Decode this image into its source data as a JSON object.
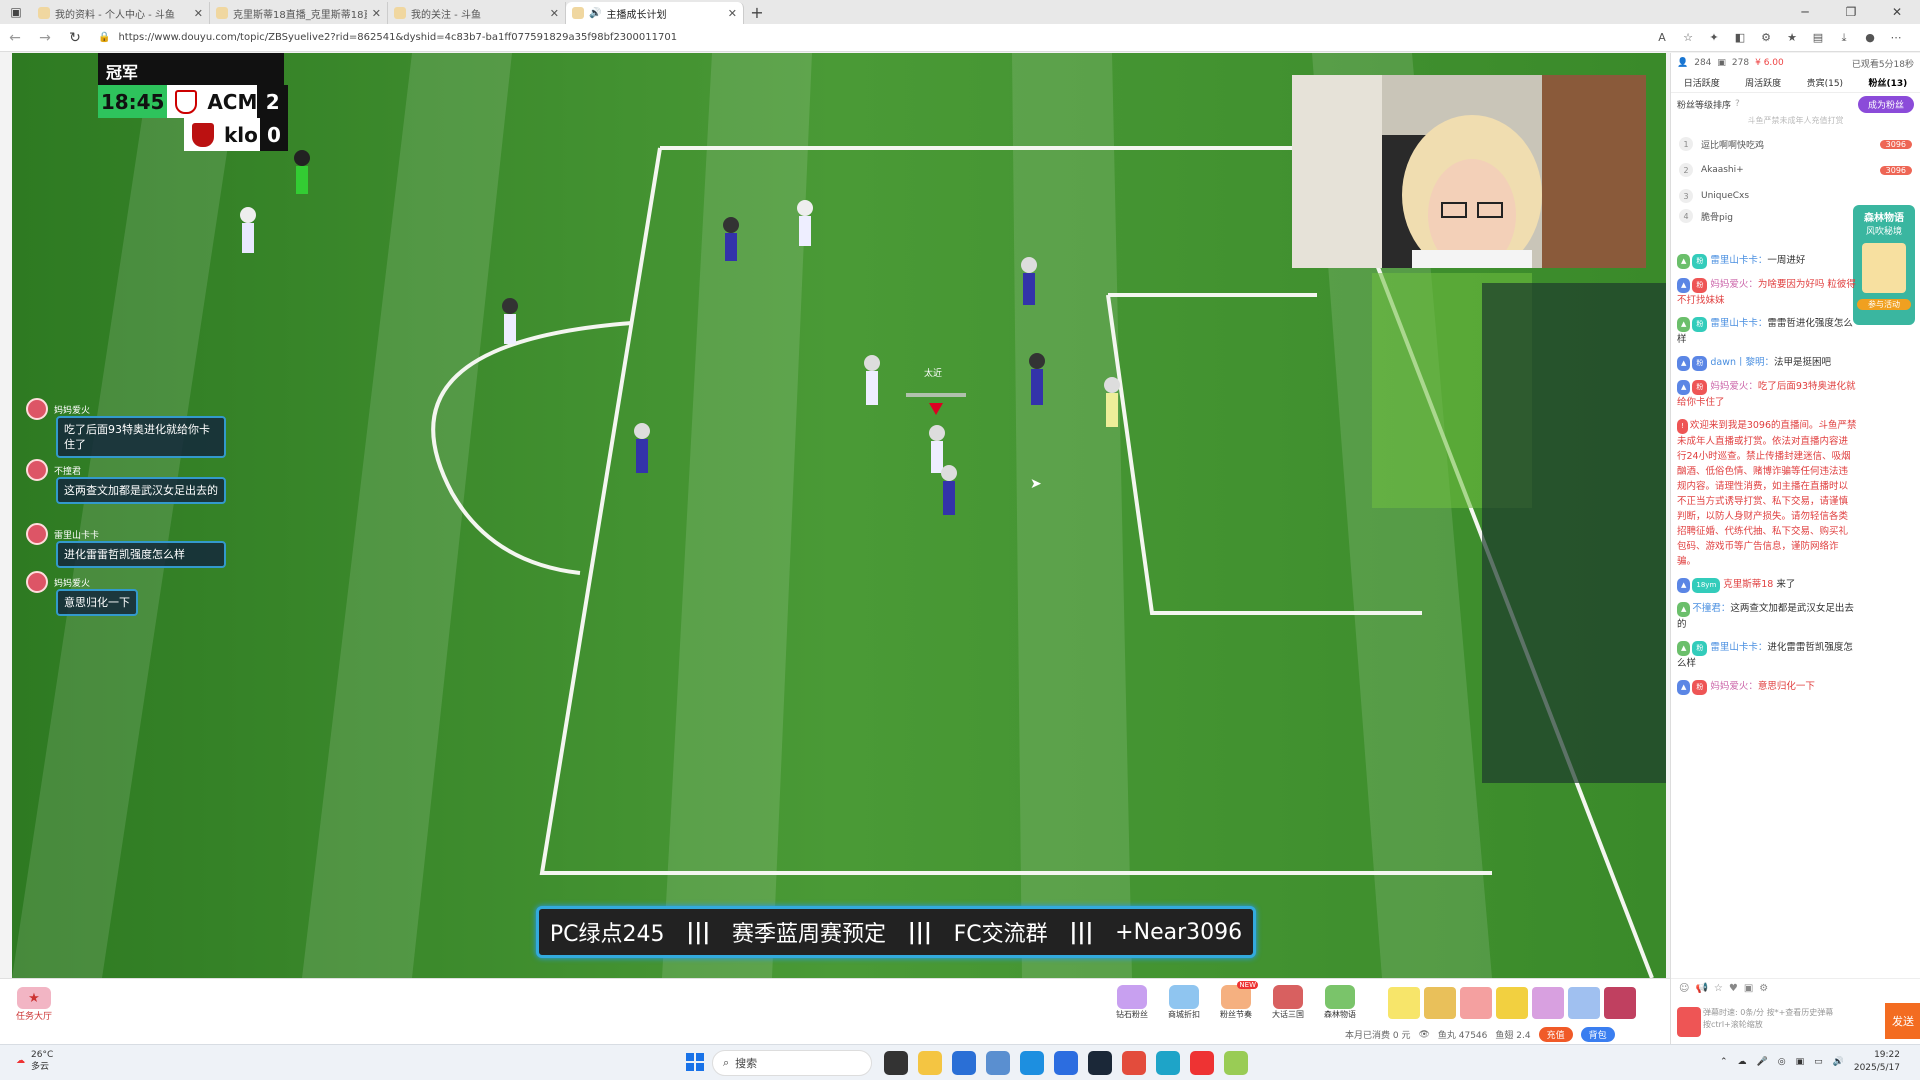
{
  "browser": {
    "tabs": [
      {
        "label": "我的资料 - 个人中心 - 斗鱼"
      },
      {
        "label": "克里斯蒂18直播_克里斯蒂18直..."
      },
      {
        "label": "我的关注 - 斗鱼"
      },
      {
        "label": "主播成长计划"
      }
    ],
    "url": "https://www.douyu.com/topic/ZBSyuelive2?rid=862541&dyshid=4c83b7-ba1ff077591829a35f98bf2300011701"
  },
  "game": {
    "scoreboard_title": "冠军",
    "clock": "18:45",
    "team_home": "ACM",
    "score_home": "2",
    "team_away": "klo",
    "score_away": "0",
    "marker_text": "太近"
  },
  "danmaku": [
    {
      "user": "妈妈爱火",
      "text": "吃了后面93特奥进化就给你卡住了"
    },
    {
      "user": "不撞君",
      "text": "这两查文加都是武汉女足出去的"
    },
    {
      "user": "雷里山卡卡",
      "text": "进化雷雷哲凯强度怎么样"
    },
    {
      "user": "妈妈爱火",
      "text": "意思归化一下"
    }
  ],
  "banner": {
    "p1": "PC绿点245",
    "p2": "赛季蓝周赛预定",
    "p3": "FC交流群",
    "p4": "+Near3096",
    "sep": "|||"
  },
  "bottombar": {
    "task_label": "任务大厅",
    "gifts": [
      "钻石粉丝",
      "商城折扣",
      "粉丝节奏",
      "大话三国",
      "森林物语"
    ],
    "gift_new": "NEW",
    "stats": "本月已消费 0 元",
    "fish_balls": "鱼丸 47546",
    "fish_wings": "鱼翅 2.4",
    "recharge": "充值",
    "backpack": "背包"
  },
  "sidebar": {
    "top_left": "284",
    "top_mid": "278",
    "top_yen": "¥ 6.00",
    "top_right": "已观看5分18秒",
    "tabs": [
      "日活跃度",
      "周活跃度",
      "贵宾(15)",
      "粉丝(13)"
    ],
    "rank_title": "粉丝等级排序",
    "become_btn": "成为粉丝",
    "notice": "斗鱼严禁未成年人充值打赏",
    "ranks": [
      {
        "n": "1",
        "name": "逗比啊啊快吃鸡",
        "score": "3096"
      },
      {
        "n": "2",
        "name": "Akaashi+",
        "score": "3096"
      },
      {
        "n": "3",
        "name": "UniqueCxs",
        "score": ""
      },
      {
        "n": "4",
        "name": "脆骨pig",
        "score": ""
      }
    ],
    "ad": {
      "title": "森林物语",
      "sub": "风吹秘境",
      "cta": "参与活动"
    },
    "chat": [
      {
        "user": "雷里山卡卡：",
        "text": "一周进好"
      },
      {
        "user": "妈妈爱火：",
        "text": "为啥要因为好吗 粒彼得不打找妹妹"
      },
      {
        "user": "雷里山卡卡：",
        "text": "雷雷哲进化强度怎么样"
      },
      {
        "user": "dawn丨黎明：",
        "text": "法甲是挺困吧"
      },
      {
        "user": "妈妈爱火：",
        "text": "吃了后面93特奥进化就给你卡住了"
      },
      {
        "system": "欢迎来到我是3096的直播间。斗鱼严禁未成年人直播或打赏。依法对直播内容进行24小时巡查。禁止传播封建迷信、吸烟酗酒、低俗色情、赌博诈骗等任何违法违规内容。请理性消费，如主播在直播时以不正当方式诱导打赏、私下交易，请谨慎判断，以防人身财产损失。请勿轻信各类招聘征婚、代练代抽、私下交易、购买礼包码、游戏币等广告信息，谨防网络诈骗。"
      },
      {
        "user": "克里斯蒂18",
        "text": "来了",
        "badge": "18ym"
      },
      {
        "user": "不撞君：",
        "text": "这两查文加都是武汉女足出去的"
      },
      {
        "user": "雷里山卡卡：",
        "text": "进化雷雷哲凯强度怎么样"
      },
      {
        "user": "妈妈爱火：",
        "text": "意思归化一下"
      }
    ],
    "input_hint1": "弹幕时速: 0条/分 按*+查看历史弹幕",
    "input_hint2": "按ctrl+滚轮缩放",
    "send": "发送"
  },
  "taskbar": {
    "temp": "26°C",
    "weather": "多云",
    "search": "搜索",
    "time": "19:22",
    "date": "2025/5/17"
  }
}
